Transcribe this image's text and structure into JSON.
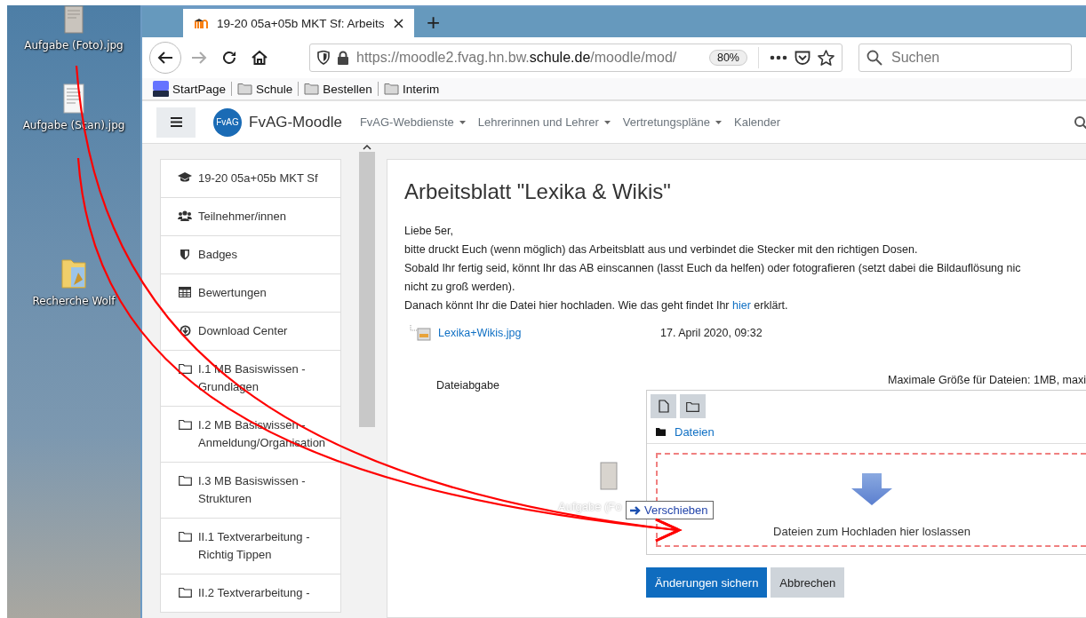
{
  "desktop": {
    "icons": [
      {
        "kind": "photo",
        "label": "Aufgabe (Foto).jpg"
      },
      {
        "kind": "scan",
        "label": "Aufgabe (Scan).jpg"
      },
      {
        "kind": "folder",
        "label": "Recherche Wolf"
      }
    ]
  },
  "browser": {
    "tabs": [
      {
        "title": "19-20 05a+05b MKT Sf: Arbeits",
        "selected": true
      }
    ],
    "new_tab": "+",
    "url": "https://moodle2.fvag.hn.bw.**schule.de**/moodle/mod/",
    "zoom": "80%",
    "search": {
      "placeholder": "Suchen"
    },
    "bookmarks": [
      {
        "kind": "site",
        "label": "StartPage"
      },
      {
        "kind": "folder",
        "label": "Schule"
      },
      {
        "kind": "folder",
        "label": "Bestellen"
      },
      {
        "kind": "folder",
        "label": "Interim"
      }
    ]
  },
  "navbar": {
    "logo": "FvAG",
    "site_name": "FvAG-Moodle",
    "menu": [
      {
        "label": "FvAG-Webdienste",
        "kind": "dropdown"
      },
      {
        "label": "Lehrerinnen und Lehrer",
        "kind": "dropdown"
      },
      {
        "label": "Vertretungspläne",
        "kind": "dropdown"
      },
      {
        "label": "Kalender",
        "kind": "link"
      }
    ]
  },
  "sidebar": {
    "items": [
      {
        "kind": "course",
        "label": "19-20 05a+05b MKT Sf"
      },
      {
        "kind": "participants",
        "label": "Teilnehmer/innen"
      },
      {
        "kind": "badges",
        "label": "Badges"
      },
      {
        "kind": "grades",
        "label": "Bewertungen"
      },
      {
        "kind": "download",
        "label": "Download Center"
      },
      {
        "kind": "section",
        "label": "I.1 MB Basiswissen - Grundlagen"
      },
      {
        "kind": "section",
        "label": "I.2 MB Basiswissen - Anmeldung/Organisation"
      },
      {
        "kind": "section",
        "label": "I.3 MB Basiswissen - Strukturen"
      },
      {
        "kind": "section",
        "label": "II.1 Textverarbeitung - Richtig Tippen"
      },
      {
        "kind": "section",
        "label": "II.2 Textverarbeitung -"
      }
    ]
  },
  "main": {
    "title": "Arbeitsblatt \"Lexika & Wikis\"",
    "intro_lines": [
      "Liebe 5er,",
      "bitte druckt Euch (wenn möglich) das Arbeitsblatt aus und verbindet die Stecker mit den richtigen Dosen.",
      "Sobald Ihr fertig seid, könnt Ihr das AB einscannen (lasst Euch da helfen) oder fotografieren (setzt dabei die Bildauflösung nic",
      "nicht zu groß werden)."
    ],
    "last_line": {
      "before": "Danach könnt Ihr die Datei hier hochladen. Wie das geht findet Ihr ",
      "link": "hier",
      "after": " erklärt."
    },
    "attachment": {
      "name": "Lexika+Wikis.jpg",
      "date": "17. April 2020, 09:32"
    },
    "field_label": "Dateiabgabe",
    "max_size": "Maximale Größe für Dateien: 1MB, maxi",
    "folder": "Dateien",
    "drop_hint": "Dateien zum Hochladen hier loslassen",
    "buttons": [
      {
        "label": "Änderungen sichern",
        "kind": "primary"
      },
      {
        "label": "Abbrechen",
        "kind": "secondary"
      }
    ]
  },
  "drag": {
    "label": "Aufgabe (Fo",
    "action": "Verschieben"
  }
}
